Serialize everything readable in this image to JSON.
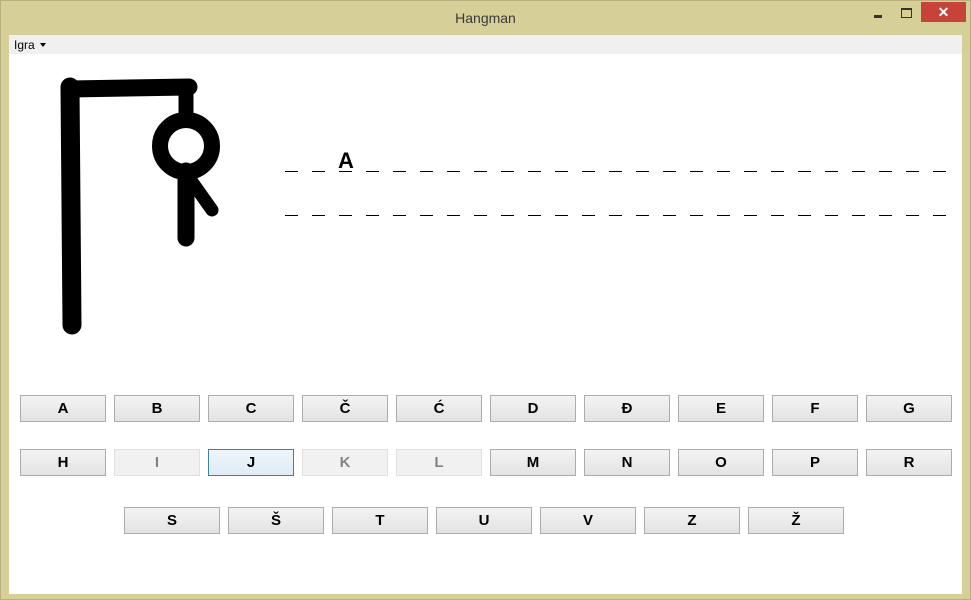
{
  "window": {
    "title": "Hangman"
  },
  "menu": {
    "items": [
      {
        "label": "Igra"
      }
    ]
  },
  "word": {
    "line1": [
      "",
      "",
      "A",
      "",
      "",
      "",
      "",
      "",
      "",
      "",
      "",
      "",
      "",
      "",
      "",
      "",
      "",
      "",
      "",
      "",
      "",
      "",
      "",
      "",
      ""
    ],
    "line2": [
      "",
      "",
      "",
      "",
      "",
      "",
      "",
      "",
      "",
      "",
      "",
      "",
      "",
      "",
      "",
      "",
      "",
      "",
      "",
      "",
      "",
      "",
      "",
      "",
      ""
    ]
  },
  "keyboard": {
    "row1": [
      {
        "label": "A",
        "state": "enabled"
      },
      {
        "label": "B",
        "state": "enabled"
      },
      {
        "label": "C",
        "state": "enabled"
      },
      {
        "label": "Č",
        "state": "enabled"
      },
      {
        "label": "Ć",
        "state": "enabled"
      },
      {
        "label": "D",
        "state": "enabled"
      },
      {
        "label": "Đ",
        "state": "enabled"
      },
      {
        "label": "E",
        "state": "enabled"
      },
      {
        "label": "F",
        "state": "enabled"
      },
      {
        "label": "G",
        "state": "enabled"
      }
    ],
    "row2": [
      {
        "label": "H",
        "state": "enabled"
      },
      {
        "label": "I",
        "state": "disabled"
      },
      {
        "label": "J",
        "state": "focused"
      },
      {
        "label": "K",
        "state": "disabled"
      },
      {
        "label": "L",
        "state": "disabled"
      },
      {
        "label": "M",
        "state": "enabled"
      },
      {
        "label": "N",
        "state": "enabled"
      },
      {
        "label": "O",
        "state": "enabled"
      },
      {
        "label": "P",
        "state": "enabled"
      },
      {
        "label": "R",
        "state": "enabled"
      }
    ],
    "row3": [
      {
        "label": "S",
        "state": "enabled"
      },
      {
        "label": "Š",
        "state": "enabled"
      },
      {
        "label": "T",
        "state": "enabled"
      },
      {
        "label": "U",
        "state": "enabled"
      },
      {
        "label": "V",
        "state": "enabled"
      },
      {
        "label": "Z",
        "state": "enabled"
      },
      {
        "label": "Ž",
        "state": "enabled"
      }
    ]
  }
}
